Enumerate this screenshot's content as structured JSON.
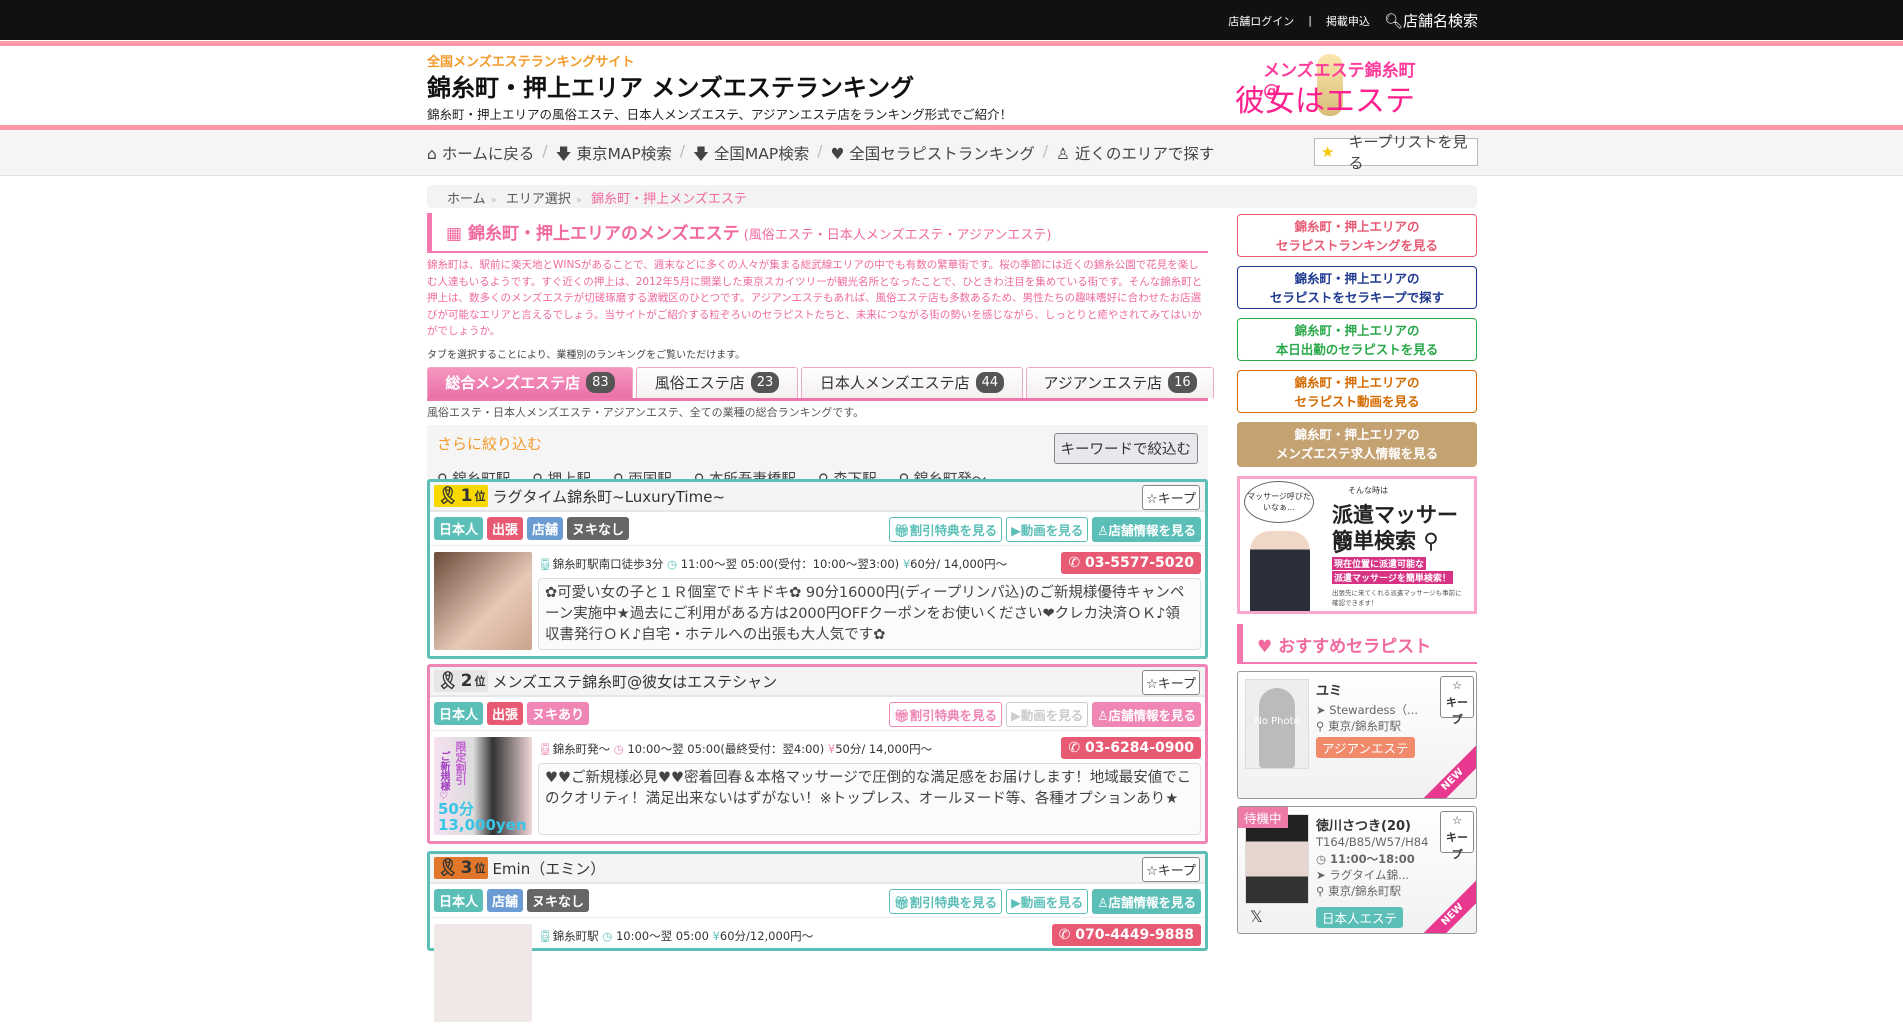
{
  "topbar": {
    "login": "店舗ログイン",
    "sep": "|",
    "apply": "掲載申込",
    "search": "店舗名検索"
  },
  "header": {
    "subtitle": "全国メンズエステランキングサイト",
    "title": "錦糸町・押上エリア メンズエステランキング",
    "description": "錦糸町・押上エリアの風俗エステ、日本人メンズエステ、アジアンエステ店をランキング形式でご紹介！",
    "logo_line1": "メンズエステ錦糸町@",
    "logo_line2": "彼女はエステシャン"
  },
  "nav": {
    "items": [
      {
        "icon": "home-icon",
        "label": "ホームに戻る"
      },
      {
        "icon": "arrow-down-icon",
        "label": "東京MAP検索"
      },
      {
        "icon": "arrow-down-icon",
        "label": "全国MAP検索"
      },
      {
        "icon": "heart-icon",
        "label": "全国セラピストランキング"
      },
      {
        "icon": "person-icon",
        "label": "近くのエリアで探す"
      }
    ],
    "keep_list": "キープリストを見る"
  },
  "breadcrumb": [
    "ホーム",
    "エリア選択",
    "錦糸町・押上メンズエステ"
  ],
  "section": {
    "title": "錦糸町・押上エリアのメンズエステ",
    "subtitle": "(風俗エステ・日本人メンズエステ・アジアンエステ)",
    "intro": "錦糸町は、駅前に楽天地とWINSがあることで、週末などに多くの人々が集まる総武線エリアの中でも有数の繁華街です。桜の季節には近くの錦糸公園で花見を楽しむ人達もいるようです。すぐ近くの押上は、2012年5月に開業した東京スカイツリーが観光名所となったことで、ひときわ注目を集めている街です。そんな錦糸町と押上は、数多くのメンズエステが切磋琢磨する激戦区のひとつです。アジアンエステもあれば、風俗エステ店も多数あるため、男性たちの趣味嗜好に合わせたお店選びが可能なエリアと言えるでしょう。当サイトがご紹介する粒ぞろいのセラピストたちと、未来につながる街の勢いを感じながら、しっとりと癒やされてみてはいかがでしょうか。",
    "tab_note": "タブを選択することにより、業種別のランキングをご覧いただけます。"
  },
  "tabs": [
    {
      "label": "総合メンズエステ店",
      "count": "83",
      "active": true
    },
    {
      "label": "風俗エステ店",
      "count": "23"
    },
    {
      "label": "日本人メンズエステ店",
      "count": "44"
    },
    {
      "label": "アジアンエステ店",
      "count": "16"
    }
  ],
  "tab_desc": "風俗エステ・日本人メンズエステ・アジアンエステ、全ての業種の総合ランキングです。",
  "filter": {
    "title": "さらに絞り込む",
    "keyword_button": "キーワードで絞込む",
    "stations": [
      "錦糸町駅",
      "押上駅",
      "両国駅",
      "本所吾妻橋駅",
      "森下駅",
      "錦糸町発～"
    ]
  },
  "buttons": {
    "keep": "☆キープ",
    "discount": "割引特典を見る",
    "video": "動画を見る",
    "store_info": "店舗情報を見る"
  },
  "shops": [
    {
      "rank": "1",
      "rank_suffix": "位",
      "name": "ラグタイム錦糸町~LuxuryTime~",
      "tags": [
        "日本人",
        "出張",
        "店舗",
        "ヌキなし"
      ],
      "access": "錦糸町駅南口徒歩3分",
      "hours": "11:00～翌 05:00(受付：10:00～翌3:00)",
      "price": "60分/ 14,000円～",
      "tel": "03-5577-5020",
      "pr": "✿可愛い女の子と１Ｒ個室でドキドキ✿ 90分16000円(ディープリンパ込)のご新規様優待キャンペーン実施中★過去にご利用がある方は2000円OFFクーポンをお使いください❤クレカ決済ＯＫ♪領収書発行ＯＫ♪自宅・ホテルへの出張も大人気です✿"
    },
    {
      "rank": "2",
      "rank_suffix": "位",
      "name": "メンズエステ錦糸町@彼女はエステシャン",
      "tags": [
        "日本人",
        "出張",
        "ヌキあり"
      ],
      "access": "錦糸町発～",
      "hours": "10:00～翌 05:00(最終受付：翌4:00)",
      "price": "50分/ 14,000円～",
      "tel": "03-6284-0900",
      "pr": "♥♥ご新規様必見♥♥密着回春＆本格マッサージで圧倒的な満足感をお届けします！地域最安値でこのクオリティ！満足出来ないはずがない！※トップレス、オールヌード等、各種オプションあり★",
      "thumb_text": [
        "限定割引",
        "ご新規様♡",
        "50分",
        "13,000yen"
      ]
    },
    {
      "rank": "3",
      "rank_suffix": "位",
      "name": "Emin（エミン）",
      "tags": [
        "日本人",
        "店舗",
        "ヌキなし"
      ],
      "access": "錦糸町駅",
      "hours": "10:00～翌 05:00",
      "price": "60分/12,000円～",
      "tel": "070-4449-9888"
    }
  ],
  "tag_colors": {
    "日本人": "#5bbfb8",
    "出張": "#e85a73",
    "店舗": "#6a9bd3",
    "ヌキなし": "#666666",
    "ヌキあり": "#ef86b6"
  },
  "sidebar": {
    "links": [
      {
        "line1": "錦糸町・押上エリアの",
        "line2": "セラピストランキングを見る",
        "color": "#e85a73"
      },
      {
        "line1": "錦糸町・押上エリアの",
        "line2": "セラピストをセラキープで探す",
        "color": "#1f3a8f"
      },
      {
        "line1": "錦糸町・押上エリアの",
        "line2": "本日出勤のセラピストを見る",
        "color": "#2aa84a"
      },
      {
        "line1": "錦糸町・押上エリアの",
        "line2": "セラピスト動画を見る",
        "color": "#d46a00"
      },
      {
        "line1": "錦糸町・押上エリアの",
        "line2": "メンズエステ求人情報を見る",
        "color": "#c4a272"
      }
    ],
    "banner": {
      "bubble": "マッサージ呼びたいなぁ…",
      "lead": "そんな時は",
      "title1": "派遣マッサージ",
      "title2": "簡単検索",
      "sub1": "現在位置に派遣可能な",
      "sub2": "派遣マッサージを簡単検索！",
      "note": "出張先に来てくれる派遣マッサージも事前に確認できます！"
    },
    "recommend_title": "おすすめセラピスト",
    "therapists": [
      {
        "name": "ユミ",
        "shop": "Stewardess（...",
        "area": "東京/錦糸町駅",
        "tag": "アジアンエステ",
        "tag_color": "#f08a6a",
        "photo": "No Photo",
        "badge": "NEW",
        "keep": "キープ"
      },
      {
        "name": "徳川さつき(20)",
        "size": "T164/B85/W57/H84",
        "hours": "11:00～18:00",
        "shop": "ラグタイム錦...",
        "area": "東京/錦糸町駅",
        "tag": "日本人エステ",
        "tag_color": "#5bbfb8",
        "status": "待機中",
        "badge": "NEW",
        "keep": "キープ"
      }
    ]
  }
}
